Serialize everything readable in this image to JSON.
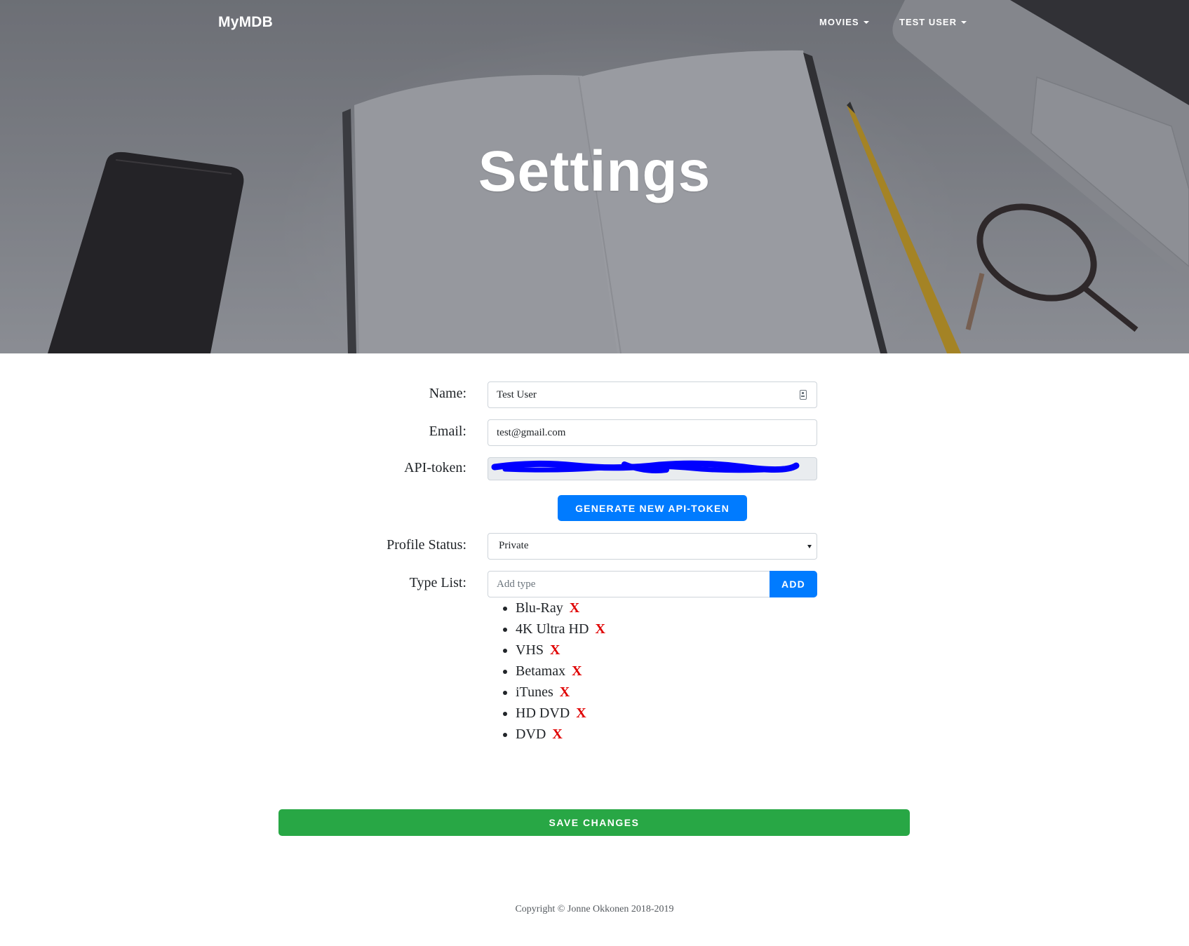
{
  "navbar": {
    "brand": "MyMDB",
    "movies_label": "MOVIES",
    "user_label": "TEST USER"
  },
  "hero": {
    "title": "Settings"
  },
  "form": {
    "name_label": "Name:",
    "name_value": "Test User",
    "email_label": "Email:",
    "email_value": "test@gmail.com",
    "api_token_label": "API-token:",
    "generate_button": "GENERATE NEW API-TOKEN",
    "profile_status_label": "Profile Status:",
    "profile_status_value": "Private",
    "type_list_label": "Type List:",
    "type_placeholder": "Add type",
    "add_button": "ADD",
    "remove_symbol": "X",
    "types": [
      "Blu-Ray",
      "4K Ultra HD",
      "VHS",
      "Betamax",
      "iTunes",
      "HD DVD",
      "DVD"
    ],
    "save_button": "SAVE CHANGES"
  },
  "footer": {
    "copyright": "Copyright © Jonne Okkonen 2018-2019"
  },
  "colors": {
    "primary": "#007bff",
    "success": "#28a745",
    "danger_x": "#e00000",
    "redaction": "#0000ff"
  }
}
